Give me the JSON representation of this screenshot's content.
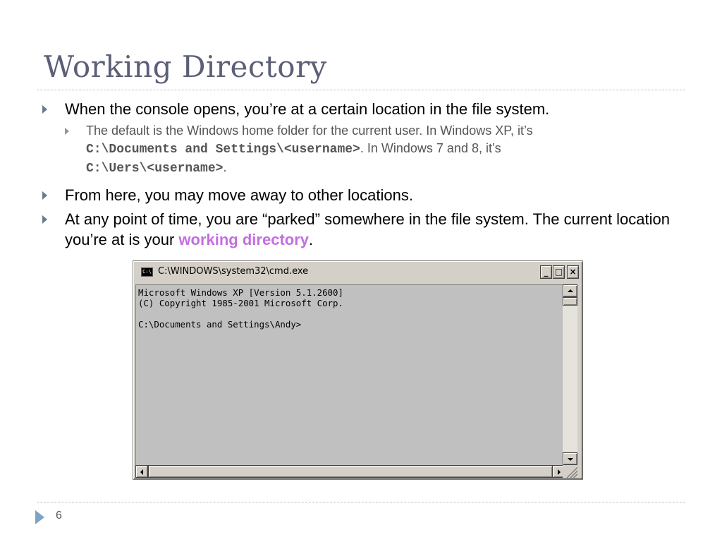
{
  "slide": {
    "title": "Working Directory",
    "page_number": "6"
  },
  "bullets": {
    "b1": "When the console opens, you’re at a certain location in the file system.",
    "b1_sub": {
      "part1": "The default is the Windows home folder for the current user. In Windows XP, it’s ",
      "code1": "C:\\Documents and Settings\\<username>",
      "part2": ". In Windows 7 and 8, it’s ",
      "code2": "C:\\Uers\\<username>",
      "part3": "."
    },
    "b2": "From here, you may move away to other locations.",
    "b3": {
      "part1": "At any point of time, you are “parked” somewhere in the file system. The current location you’re at is your ",
      "highlight": "working directory",
      "part2": "."
    }
  },
  "cmd_window": {
    "icon_label": "C:\\",
    "title": "C:\\WINDOWS\\system32\\cmd.exe",
    "minimize": "_",
    "maximize": "□",
    "close": "×",
    "console_text": "Microsoft Windows XP [Version 5.1.2600]\n(C) Copyright 1985-2001 Microsoft Corp.\n\nC:\\Documents and Settings\\Andy>"
  },
  "colors": {
    "title": "#5b5f77",
    "highlight": "#c36ee0",
    "bullet_arrow": "#6a7a93",
    "window_face": "#d4d0c8",
    "console_bg": "#c0c0c0"
  }
}
